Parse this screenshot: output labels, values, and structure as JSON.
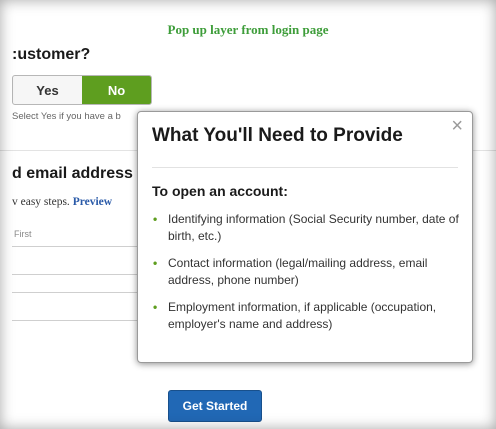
{
  "caption": "Pop up layer from login page",
  "background": {
    "customer_heading": ":ustomer?",
    "toggle": {
      "yes_label": "Yes",
      "no_label": "No",
      "selected": "No"
    },
    "helper_text": "Select Yes if you have a b",
    "email_heading": "d email address",
    "steps_text": "v easy steps.",
    "preview_link": "Preview",
    "first_label": "First",
    "get_started_label": "Get Started"
  },
  "modal": {
    "title": "What You'll Need to Provide",
    "close_glyph": "×",
    "subhead": "To open an account:",
    "bullet_glyph": "•",
    "items": [
      "Identifying information (Social Security number, date of birth, etc.)",
      "Contact information (legal/mailing address, email address, phone number)",
      "Employment information, if applicable (occupation, employer's name and address)"
    ]
  },
  "colors": {
    "caption_green": "#3e9d3a",
    "toggle_active": "#5e9e1f",
    "button_blue": "#2168b5",
    "link_blue": "#2a5aa8"
  }
}
